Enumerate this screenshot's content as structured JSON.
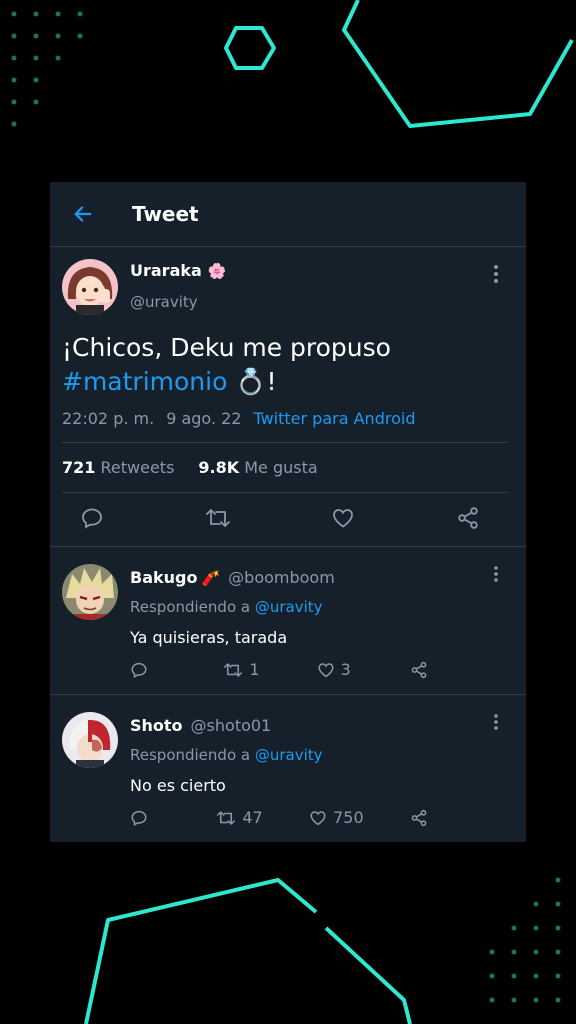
{
  "header": {
    "title": "Tweet"
  },
  "tweet": {
    "name": "Uraraka",
    "name_emoji": "🌸",
    "handle": "@uravity",
    "text_before": "¡Chicos, Deku me propuso",
    "hashtag": "#matrimonio",
    "ring": "💍",
    "text_after": "!",
    "time": "22:02 p. m.",
    "date": "9 ago. 22",
    "source": "Twitter para Android",
    "retweets_count": "721",
    "retweets_label": "Retweets",
    "likes_count": "9.8K",
    "likes_label": "Me gusta"
  },
  "replies": [
    {
      "name": "Bakugo",
      "emoji": "🧨",
      "handle": "@boomboom",
      "replying_prefix": "Respondiendo a",
      "replying_to": "@uravity",
      "text": "Ya quisieras, tarada",
      "retweets": "1",
      "likes": "3"
    },
    {
      "name": "Shoto",
      "emoji": "",
      "handle": "@shoto01",
      "replying_prefix": "Respondiendo a",
      "replying_to": "@uravity",
      "text": "No es cierto",
      "retweets": "47",
      "likes": "750"
    }
  ],
  "colors": {
    "card": "#15202b",
    "accent": "#1d9bf0",
    "muted": "#8b98a5",
    "neon": "#2de8d0"
  },
  "icons": [
    "back-arrow-icon",
    "more-icon",
    "reply-icon",
    "retweet-icon",
    "like-icon",
    "share-icon"
  ]
}
